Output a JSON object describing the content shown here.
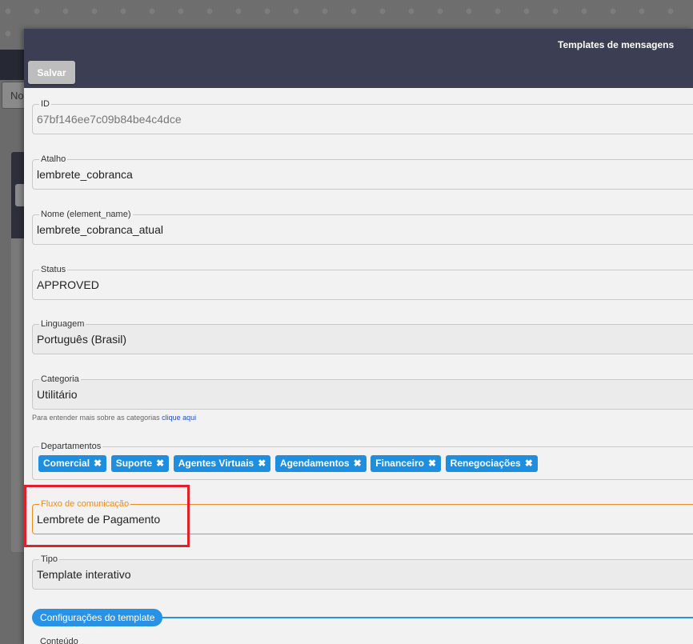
{
  "background": {
    "search_stub": "No"
  },
  "modal": {
    "title": "Templates de mensagens",
    "save_label": "Salvar"
  },
  "fields": {
    "id": {
      "label": "ID",
      "value": "67bf146ee7c09b84be4c4dce"
    },
    "atalho": {
      "label": "Atalho",
      "value": "lembrete_cobranca"
    },
    "nome": {
      "label": "Nome (element_name)",
      "value": "lembrete_cobranca_atual"
    },
    "status": {
      "label": "Status",
      "value": "APPROVED"
    },
    "linguagem": {
      "label": "Linguagem",
      "value": "Português (Brasil)"
    },
    "categoria": {
      "label": "Categoria",
      "value": "Utilitário"
    },
    "departamentos": {
      "label": "Departamentos"
    },
    "fluxo": {
      "label": "Fluxo de comunicação",
      "value": "Lembrete de Pagamento"
    },
    "tipo": {
      "label": "Tipo",
      "value": "Template interativo"
    }
  },
  "category_hint": {
    "text": "Para entender mais sobre as categorias ",
    "link": "clique aqui"
  },
  "departments": [
    "Comercial",
    "Suporte",
    "Agentes Virtuais",
    "Agendamentos",
    "Financeiro",
    "Renegociações"
  ],
  "section": {
    "label": "Configurações do template"
  },
  "next_field_label": "Conteúdo",
  "colors": {
    "header_bg": "#3c3e53",
    "chip_bg": "#1e8fe0",
    "focus_accent": "#f08a1c",
    "highlight": "#e0202a",
    "section_accent": "#2893e6"
  }
}
